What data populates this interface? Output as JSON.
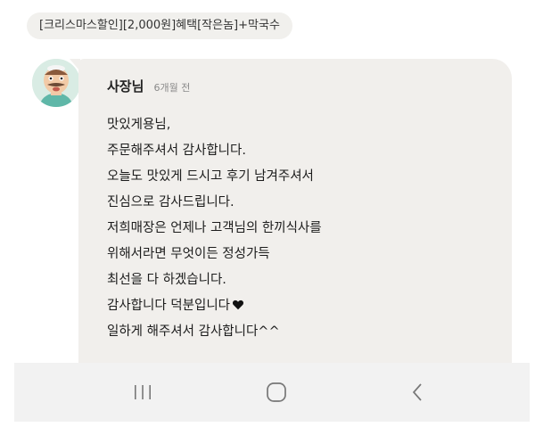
{
  "menu_tag": "[크리스마스할인][2,000원]혜택[작은놈]+막국수",
  "reply": {
    "author": "사장님",
    "time": "6개월 전",
    "lines": [
      "맛있게용님,",
      "주문해주셔서 감사합니다.",
      "오늘도 맛있게 드시고 후기 남겨주셔서",
      "진심으로 감사드립니다.",
      "저희매장은 언제나 고객님의 한끼식사를",
      "위해서라면 무엇이든 정성가득",
      "최선을 다 하겠습니다.",
      "감사합니다 덕분입니다",
      "일하게 해주셔서 감사합니다^^"
    ],
    "heart_icon": "black-heart-icon"
  },
  "navbar": {
    "recents_icon": "recents-icon",
    "home_icon": "home-icon",
    "back_icon": "back-icon"
  }
}
